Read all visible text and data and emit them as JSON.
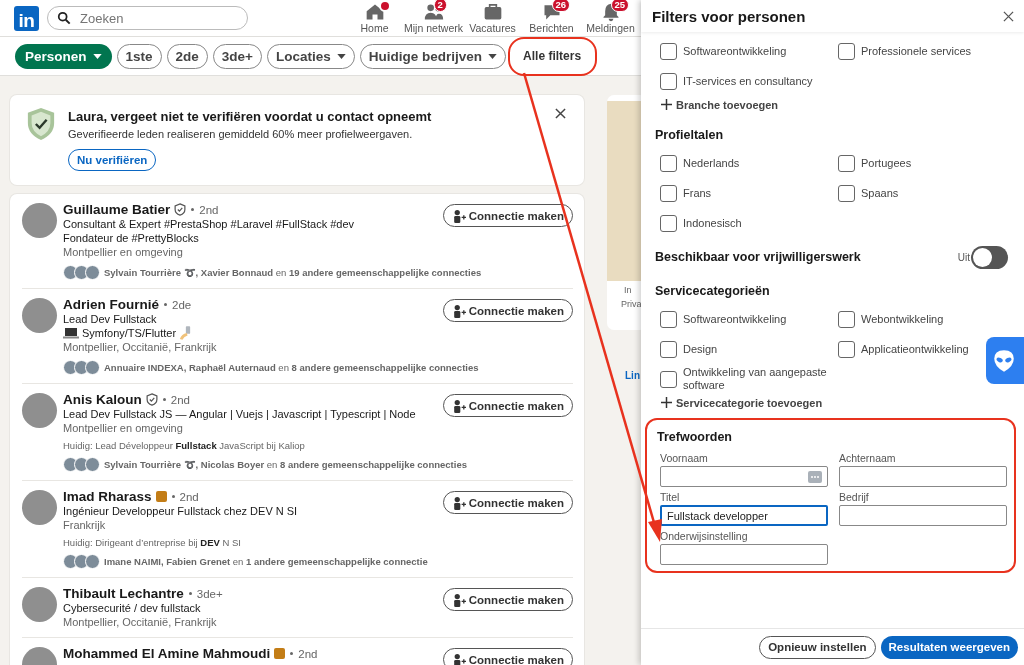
{
  "logo": "in",
  "search": {
    "placeholder": "Zoeken"
  },
  "nav": [
    {
      "label": "Home",
      "dot": true
    },
    {
      "label": "Mijn netwerk",
      "dot": false,
      "badge": "2"
    },
    {
      "label": "Vacatures",
      "dot": false
    },
    {
      "label": "Berichten",
      "dot": false,
      "badge": "26"
    },
    {
      "label": "Meldingen",
      "dot": false,
      "badge": "25"
    }
  ],
  "filters": [
    {
      "label": "Personen",
      "kind": "primary",
      "dropdown": true,
      "highlighted": false
    },
    {
      "label": "1ste",
      "kind": "pill",
      "dropdown": false,
      "highlighted": false
    },
    {
      "label": "2de",
      "kind": "pill",
      "dropdown": false,
      "highlighted": false
    },
    {
      "label": "3de+",
      "kind": "pill",
      "dropdown": false,
      "highlighted": false
    },
    {
      "label": "Locaties",
      "kind": "pill",
      "dropdown": true,
      "highlighted": false
    },
    {
      "label": "Huidige bedrijven",
      "kind": "pill",
      "dropdown": true,
      "highlighted": false
    },
    {
      "label": "Alle filters",
      "kind": "text",
      "dropdown": false,
      "highlighted": true
    }
  ],
  "banner": {
    "title": "Laura, vergeet niet te verifiëren voordat u contact opneemt",
    "text": "Geverifieerde leden realiseren gemiddeld 60% meer profielweergaven.",
    "button": "Nu verifiëren"
  },
  "results": [
    {
      "name": "Guillaume Batier",
      "verified": true,
      "premium": false,
      "degree": "2nd",
      "headline": [
        {
          "text": "Consultant & Expert #PrestaShop #Laravel #FullStack #dev",
          "decorated": false
        },
        {
          "text": "Fondateur de #PrettyBlocks",
          "decorated": false
        }
      ],
      "location": "Montpellier en omgeving",
      "mutual": "**Sylvain Tourrière ➰, Xavier Bonnaud** en **19 andere gemeenschappelijke connecties**",
      "action": "Connectie maken"
    },
    {
      "name": "Adrien Fournié",
      "verified": false,
      "premium": false,
      "degree": "2de",
      "headline": [
        {
          "text": "Lead Dev Fullstack",
          "decorated": false
        },
        {
          "text": "Symfony/TS/Flutter",
          "decorated": true
        }
      ],
      "location": "Montpellier, Occitanië, Frankrijk",
      "mutual": "**Annuaire INDEXA, Raphaël Auternaud** en **8 andere gemeenschappelijke connecties**",
      "action": "Connectie maken"
    },
    {
      "name": "Anis Kaloun",
      "verified": true,
      "premium": false,
      "degree": "2nd",
      "headline": [
        {
          "text": "Lead Dev Fullstack JS — Angular | Vuejs | Javascript | Typescript | Node",
          "decorated": false
        }
      ],
      "location": "Montpellier en omgeving",
      "current": "Huidig: Lead Développeur **Fullstack** JavaScript bij Kaliop",
      "mutual": "**Sylvain Tourrière ➰, Nicolas Boyer** en **8 andere gemeenschappelijke connecties**",
      "action": "Connectie maken"
    },
    {
      "name": "Imad Rharass",
      "verified": false,
      "premium": true,
      "degree": "2nd",
      "headline": [
        {
          "text": "Ingénieur Developpeur Fullstack chez DEV N SI",
          "decorated": false
        }
      ],
      "location": "Frankrijk",
      "current": "Huidig: Dirigeant d’entreprise bij **DEV** N SI",
      "mutual": "**Imane NAIMI, Fabien Grenet** en **1 andere gemeenschappelijke connectie**",
      "action": "Connectie maken"
    },
    {
      "name": "Thibault Lechantre",
      "verified": false,
      "premium": false,
      "degree": "3de+",
      "headline": [
        {
          "text": "Cybersecurité / dev fullstack",
          "decorated": false
        }
      ],
      "location": "Montpellier, Occitanië, Frankrijk",
      "action": "Connectie maken"
    },
    {
      "name": "Mohammed El Amine Mahmoudi",
      "verified": false,
      "premium": true,
      "degree": "2nd",
      "action": "Connectie maken"
    }
  ],
  "rail": {
    "lines": [
      "In",
      "Priva"
    ],
    "link": "Lin"
  },
  "panel": {
    "title": "Filters voor personen",
    "sections": [
      {
        "kind": "checkboxes",
        "options": [
          {
            "label": "Softwareontwikkeling",
            "checked": false
          },
          {
            "label": "Professionele services",
            "checked": false
          },
          {
            "label": "IT-services en consultancy",
            "checked": false
          }
        ],
        "add": "Branche toevoegen"
      },
      {
        "kind": "checkboxes",
        "title": "Profieltalen",
        "options": [
          {
            "label": "Nederlands",
            "checked": false
          },
          {
            "label": "Portugees",
            "checked": false
          },
          {
            "label": "Frans",
            "checked": false
          },
          {
            "label": "Spaans",
            "checked": false
          },
          {
            "label": "Indonesisch",
            "checked": false
          }
        ]
      },
      {
        "kind": "toggle",
        "title": "Beschikbaar voor vrijwilligerswerk",
        "state": "Uit",
        "on": false
      },
      {
        "kind": "checkboxes",
        "title": "Servicecategorieën",
        "options": [
          {
            "label": "Softwareontwikkeling",
            "checked": false
          },
          {
            "label": "Webontwikkeling",
            "checked": false
          },
          {
            "label": "Design",
            "checked": false
          },
          {
            "label": "Applicatieontwikkeling",
            "checked": false
          },
          {
            "label": "Ontwikkeling van aangepaste software",
            "checked": false
          }
        ],
        "add": "Servicecategorie toevoegen"
      },
      {
        "kind": "fields",
        "title": "Trefwoorden",
        "highlighted": true,
        "fields": [
          {
            "label": "Voornaam",
            "autofill": true,
            "focused": false
          },
          {
            "label": "Achternaam",
            "autofill": false,
            "focused": false
          },
          {
            "label": "Titel",
            "value": "Fullstack developper",
            "autofill": false,
            "focused": true
          },
          {
            "label": "Bedrijf",
            "autofill": false,
            "focused": false
          },
          {
            "label": "Onderwijsinstelling",
            "autofill": false,
            "focused": false
          }
        ]
      }
    ],
    "reset": "Opnieuw instellen",
    "apply": "Resultaten weergeven"
  }
}
